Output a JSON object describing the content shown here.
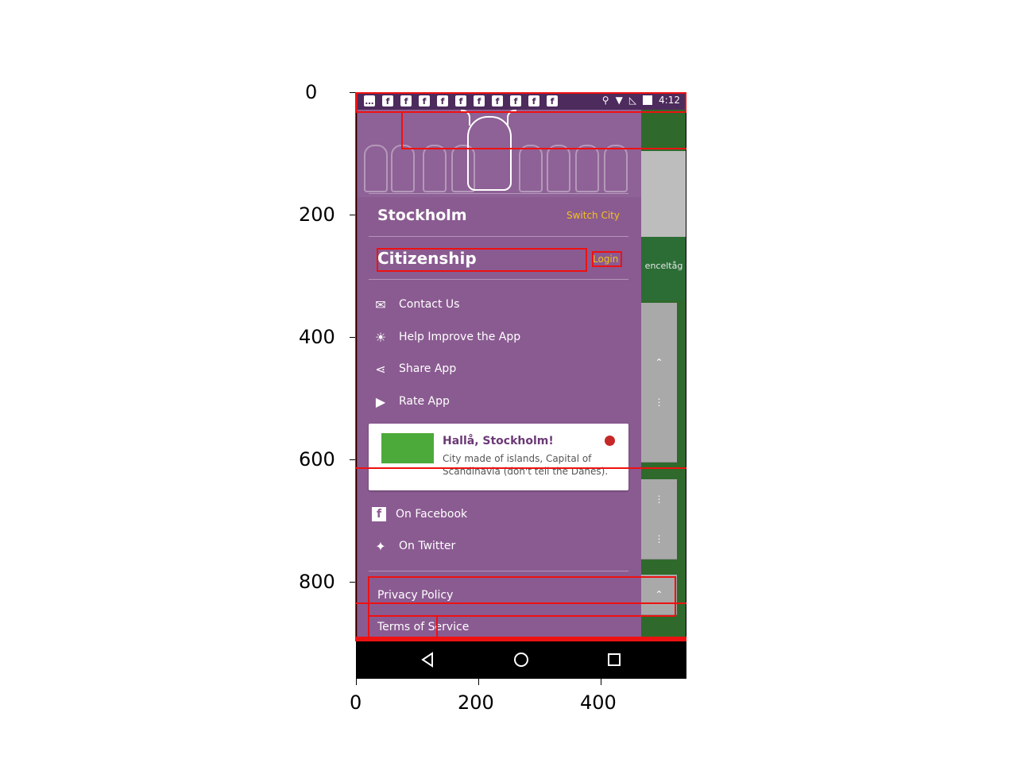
{
  "status_bar": {
    "time": "4:12",
    "notification_icons": [
      "message-icon",
      "facebook-icon",
      "facebook-icon",
      "facebook-icon",
      "facebook-icon",
      "facebook-icon",
      "facebook-icon",
      "facebook-icon",
      "facebook-icon",
      "facebook-icon",
      "facebook-icon"
    ],
    "right_icons": [
      "location-icon",
      "wifi-icon",
      "signal-off-icon",
      "battery-charging-icon"
    ]
  },
  "drawer": {
    "city": "Stockholm",
    "switch_city": "Switch City",
    "citizenship": "Citizenship",
    "login": "Login",
    "menu_items": [
      {
        "label": "Contact Us",
        "icon": "mail-icon"
      },
      {
        "label": "Help Improve the App",
        "icon": "lightbulb-icon"
      },
      {
        "label": "Share App",
        "icon": "share-icon"
      },
      {
        "label": "Rate App",
        "icon": "play-store-icon"
      }
    ],
    "promo": {
      "title": "Hallå, Stockholm!",
      "text": "City made of islands, Capital of Scandinavia (don't tell the Danes)."
    },
    "social": [
      {
        "label": "On Facebook",
        "icon": "facebook-icon"
      },
      {
        "label": "On Twitter",
        "icon": "twitter-icon"
      }
    ],
    "footer_links": [
      "Privacy Policy",
      "Terms of Service"
    ]
  },
  "background_app": {
    "peek_label": "enceltåg"
  },
  "axes": {
    "y_ticks": [
      "0",
      "200",
      "400",
      "600",
      "800"
    ],
    "x_ticks": [
      "0",
      "200",
      "400"
    ]
  },
  "colors": {
    "drawer": "#8a5b91",
    "accent": "#f4c21b",
    "status_bar": "#4d2b5c",
    "annotation": "#e11111"
  }
}
